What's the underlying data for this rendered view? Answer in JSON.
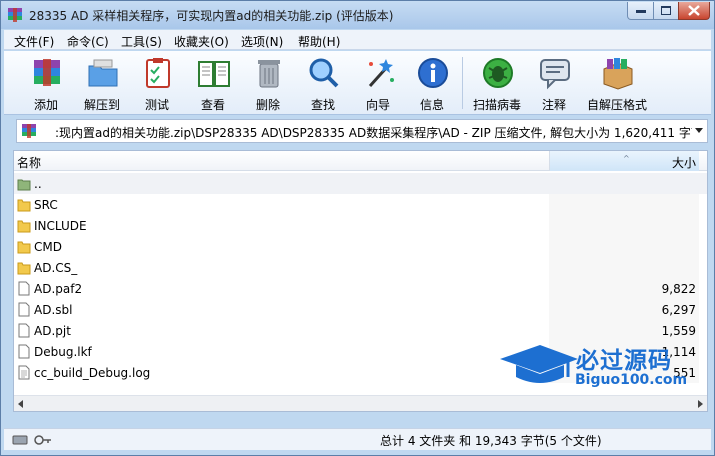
{
  "window": {
    "title": "28335 AD 采样相关程序，可实现内置ad的相关功能.zip (评估版本)"
  },
  "menu": [
    "文件(F)",
    "命令(C)",
    "工具(S)",
    "收藏夹(O)",
    "选项(N)",
    "帮助(H)"
  ],
  "toolbar": [
    {
      "label": "添加",
      "icon": "add-archive-icon"
    },
    {
      "label": "解压到",
      "icon": "extract-to-icon"
    },
    {
      "label": "测试",
      "icon": "test-icon"
    },
    {
      "label": "查看",
      "icon": "view-book-icon"
    },
    {
      "label": "删除",
      "icon": "delete-trash-icon"
    },
    {
      "label": "查找",
      "icon": "find-magnifier-icon"
    },
    {
      "label": "向导",
      "icon": "wizard-wand-icon"
    },
    {
      "label": "信息",
      "icon": "info-icon"
    },
    {
      "label": "扫描病毒",
      "icon": "virus-scan-bug-icon"
    },
    {
      "label": "注释",
      "icon": "comment-icon"
    },
    {
      "label": "自解压格式",
      "icon": "sfx-box-icon"
    }
  ],
  "address": {
    "path": ":现内置ad的相关功能.zip\\DSP28335 AD\\DSP28335 AD数据采集程序\\AD - ZIP 压缩文件, 解包大小为 1,620,411 字节"
  },
  "columns": {
    "name": "名称",
    "size": "大小"
  },
  "files": [
    {
      "name": "..",
      "size": "",
      "type": "parent"
    },
    {
      "name": "SRC",
      "size": "",
      "type": "folder"
    },
    {
      "name": "INCLUDE",
      "size": "",
      "type": "folder"
    },
    {
      "name": "CMD",
      "size": "",
      "type": "folder"
    },
    {
      "name": "AD.CS_",
      "size": "",
      "type": "folder"
    },
    {
      "name": "AD.paf2",
      "size": "9,822",
      "type": "file"
    },
    {
      "name": "AD.sbl",
      "size": "6,297",
      "type": "file"
    },
    {
      "name": "AD.pjt",
      "size": "1,559",
      "type": "file"
    },
    {
      "name": "Debug.lkf",
      "size": "1,114",
      "type": "file"
    },
    {
      "name": "cc_build_Debug.log",
      "size": "551",
      "type": "textfile"
    }
  ],
  "status": {
    "text": "总计 4 文件夹 和 19,343 字节(5 个文件)"
  },
  "watermark": {
    "title": "必过源码",
    "subtitle": "Biguo100.com"
  },
  "colors": {
    "accent": "#1d6fd1",
    "folder": "#f2c94c",
    "titlebar": "#bfd8f0"
  }
}
